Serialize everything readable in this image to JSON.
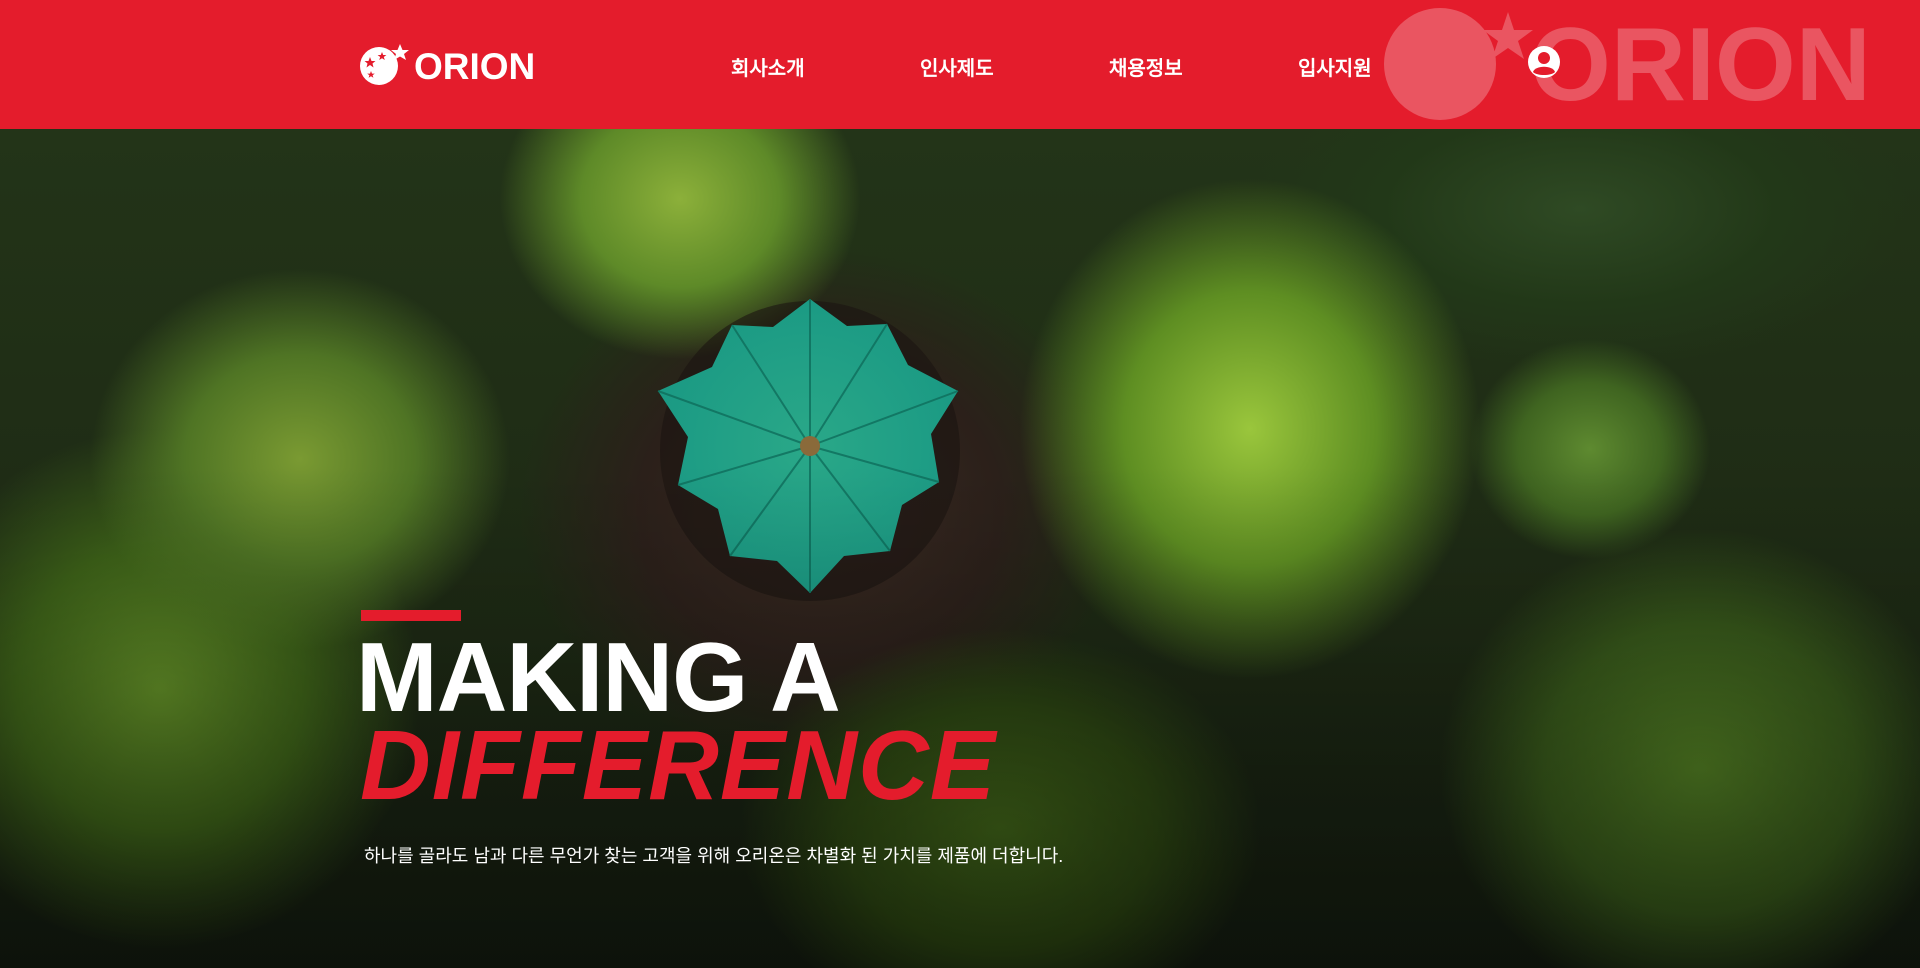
{
  "header": {
    "logo_text": "ORION",
    "watermark_text": "ORION",
    "nav": [
      {
        "label": "회사소개"
      },
      {
        "label": "인사제도"
      },
      {
        "label": "채용정보"
      },
      {
        "label": "입사지원"
      }
    ],
    "user_icon": "user-circle-icon"
  },
  "hero": {
    "title_line1": "MAKING A",
    "title_line2": "DIFFERENCE",
    "subtitle": "하나를 골라도 남과 다른 무언가 찾는 고객을 위해 오리온은 차별화 된 가치를 제품에 더합니다."
  },
  "colors": {
    "brand_red": "#e41c2c",
    "white": "#ffffff"
  }
}
